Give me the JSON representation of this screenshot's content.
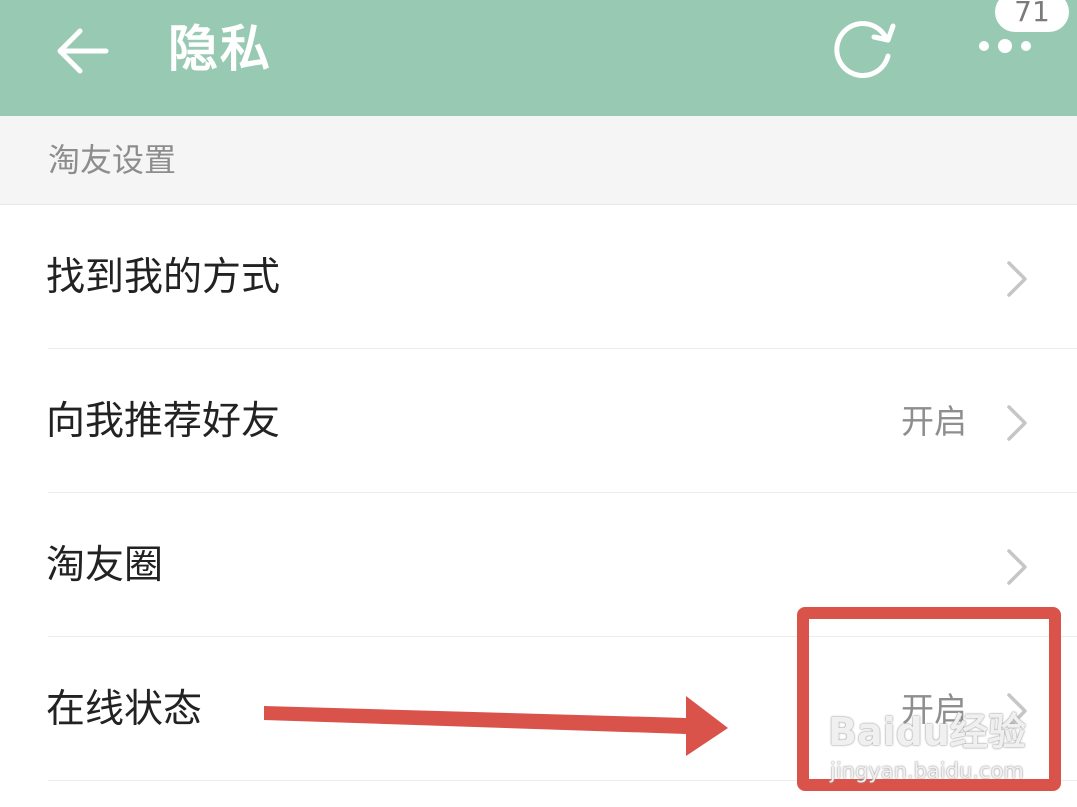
{
  "header": {
    "title": "隐私",
    "back_icon": "arrow-left-icon",
    "refresh_icon": "refresh-icon",
    "more_icon": "more-dots-icon",
    "badge_count": "71",
    "background_color": "#98cab3"
  },
  "section": {
    "title": "淘友设置"
  },
  "rows": [
    {
      "label": "找到我的方式",
      "value": ""
    },
    {
      "label": "向我推荐好友",
      "value": "开启"
    },
    {
      "label": "淘友圈",
      "value": ""
    },
    {
      "label": "在线状态",
      "value": "开启"
    }
  ],
  "annotation": {
    "color": "#d9534a"
  },
  "watermark": {
    "logo": "Baidu经验",
    "url": "jingyan.baidu.com"
  }
}
